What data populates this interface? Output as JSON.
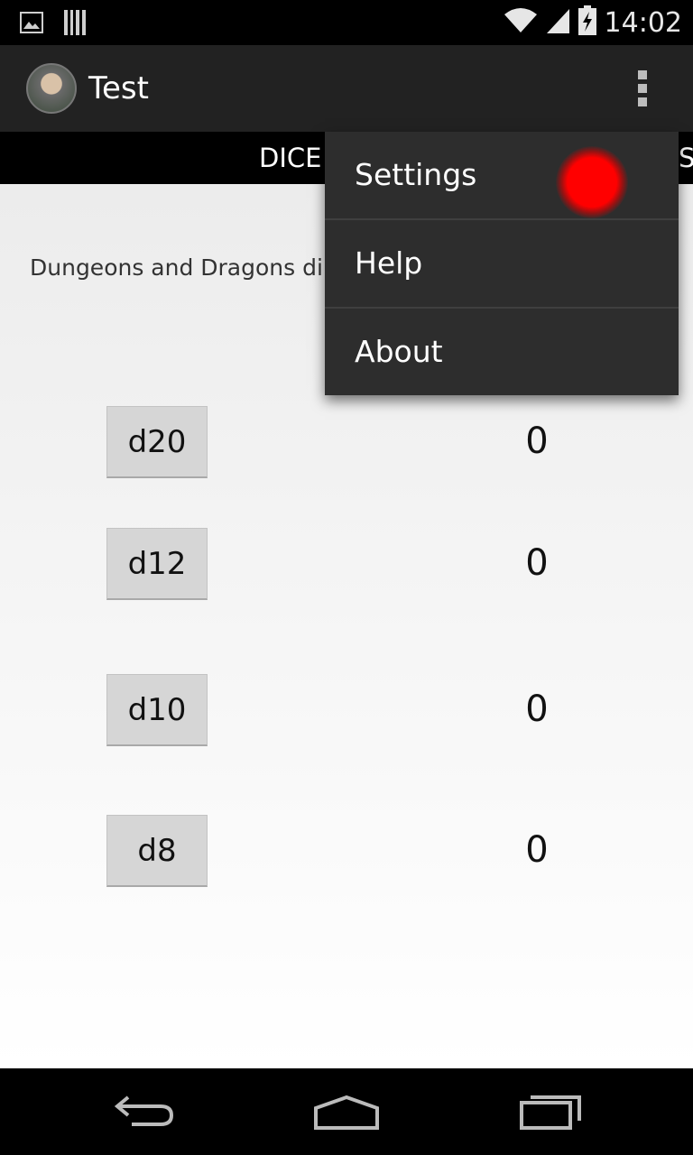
{
  "status_bar": {
    "time": "14:02",
    "icons": [
      "image-icon",
      "barcode-icon",
      "wifi-icon",
      "signal-icon",
      "battery-charging-icon"
    ]
  },
  "action_bar": {
    "title": "Test",
    "overflow_icon": "more-vert-icon"
  },
  "tabs": [
    {
      "label": "DICE"
    },
    {
      "label": "S"
    }
  ],
  "content": {
    "description": "Dungeons and Dragons di",
    "dice": [
      {
        "label": "d20",
        "value": "0"
      },
      {
        "label": "d12",
        "value": "0"
      },
      {
        "label": "d10",
        "value": "0"
      },
      {
        "label": "d8",
        "value": "0"
      }
    ]
  },
  "menu": {
    "items": [
      {
        "label": "Settings"
      },
      {
        "label": "Help"
      },
      {
        "label": "About"
      }
    ]
  },
  "nav_bar": {
    "icons": [
      "back-icon",
      "home-icon",
      "recents-icon"
    ]
  },
  "colors": {
    "action_bar": "#222222",
    "menu_bg": "#2d2d2d",
    "tap_indicator": "#ff0000"
  }
}
